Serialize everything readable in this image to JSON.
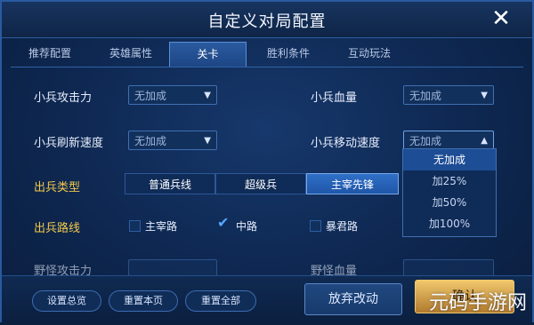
{
  "header": {
    "title": "自定义对局配置"
  },
  "tabs": [
    {
      "label": "推荐配置"
    },
    {
      "label": "英雄属性"
    },
    {
      "label": "关卡",
      "active": true
    },
    {
      "label": "胜利条件"
    },
    {
      "label": "互动玩法"
    }
  ],
  "settings": {
    "minion_attack": {
      "label": "小兵攻击力",
      "value": "无加成"
    },
    "minion_hp": {
      "label": "小兵血量",
      "value": "无加成"
    },
    "minion_refresh": {
      "label": "小兵刷新速度",
      "value": "无加成"
    },
    "minion_move": {
      "label": "小兵移动速度",
      "value": "无加成"
    },
    "minion_type": {
      "label": "出兵类型",
      "options": [
        "普通兵线",
        "超级兵",
        "主宰先锋"
      ],
      "selected": "主宰先锋"
    },
    "minion_lane": {
      "label": "出兵路线",
      "lanes": [
        {
          "label": "主宰路",
          "checked": false
        },
        {
          "label": "中路",
          "checked": true
        },
        {
          "label": "暴君路",
          "checked": false
        }
      ]
    },
    "partial_row_left": "野怪攻击力",
    "partial_row_right": "野怪血量"
  },
  "dropdown_move_speed": {
    "options": [
      "无加成",
      "加25%",
      "加50%",
      "加100%"
    ],
    "selected": "无加成"
  },
  "bottom": {
    "settings_overview": "设置总览",
    "reset_page": "重置本页",
    "reset_all": "重置全部",
    "discard_changes": "放弃改动",
    "confirm": "确认"
  },
  "watermark": "元码手游网"
}
